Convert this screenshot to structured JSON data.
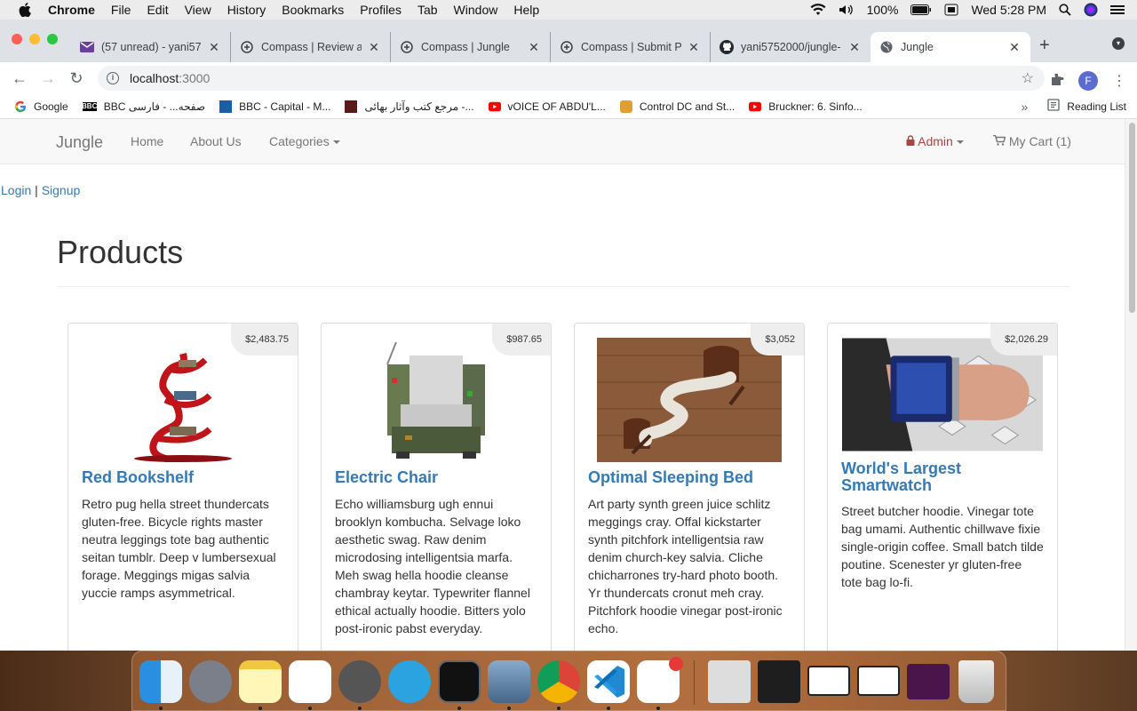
{
  "menubar": {
    "app": "Chrome",
    "items": [
      "File",
      "Edit",
      "View",
      "History",
      "Bookmarks",
      "Profiles",
      "Tab",
      "Window",
      "Help"
    ],
    "battery": "100%",
    "clock": "Wed 5:28 PM"
  },
  "tabs": [
    {
      "title": "(57 unread) - yani57",
      "icon": "mail-icon"
    },
    {
      "title": "Compass | Review a",
      "icon": "compass-icon"
    },
    {
      "title": "Compass | Jungle",
      "icon": "compass-icon"
    },
    {
      "title": "Compass | Submit P",
      "icon": "compass-icon"
    },
    {
      "title": "yani5752000/jungle-",
      "icon": "github-icon"
    },
    {
      "title": "Jungle",
      "icon": "globe-icon",
      "active": true
    }
  ],
  "address": {
    "host": "localhost",
    "port": ":3000"
  },
  "bookmarks": [
    {
      "label": "Google",
      "icon": "google-icon"
    },
    {
      "label": "BBC صفحه... - فارسی",
      "icon": "bbc-icon"
    },
    {
      "label": "BBC - Capital - M...",
      "icon": "bbc-capital-icon"
    },
    {
      "label": "مرجع کتب وآثار بهائی -...",
      "icon": "book-icon"
    },
    {
      "label": "vOICE OF ABDU'L...",
      "icon": "youtube-icon"
    },
    {
      "label": "Control DC and St...",
      "icon": "motor-icon"
    },
    {
      "label": "Bruckner: 6. Sinfo...",
      "icon": "youtube-icon"
    }
  ],
  "reading_list": "Reading List",
  "profile_initial": "F",
  "site": {
    "brand": "Jungle",
    "nav": {
      "home": "Home",
      "about": "About Us",
      "categories": "Categories"
    },
    "admin": "Admin",
    "cart": "My Cart (1)",
    "login": "Login",
    "separator": "|",
    "signup": "Signup",
    "heading": "Products"
  },
  "products": [
    {
      "name": "Red Bookshelf",
      "price": "$2,483.75",
      "description": "Retro pug hella street thundercats gluten-free. Bicycle rights master neutra leggings tote bag authentic seitan tumblr. Deep v lumbersexual forage. Meggings migas salvia yuccie ramps asymmetrical."
    },
    {
      "name": "Electric Chair",
      "price": "$987.65",
      "description": "Echo williamsburg ugh ennui brooklyn kombucha. Selvage loko aesthetic swag. Raw denim microdosing intelligentsia marfa. Meh swag hella hoodie cleanse chambray keytar. Typewriter flannel ethical actually hoodie. Bitters yolo post-ironic pabst everyday."
    },
    {
      "name": "Optimal Sleeping Bed",
      "price": "$3,052",
      "description": "Art party synth green juice schlitz meggings cray. Offal kickstarter synth pitchfork intelligentsia raw denim church-key salvia. Cliche chicharrones try-hard photo booth. Yr thundercats cronut meh cray. Pitchfork hoodie vinegar post-ironic echo."
    },
    {
      "name": "World's Largest Smartwatch",
      "price": "$2,026.29",
      "description": "Street butcher hoodie. Vinegar tote bag umami. Authentic chillwave fixie single-origin coffee. Small batch tilde poutine. Scenester yr gluten-free tote bag lo-fi."
    }
  ],
  "dock": [
    "finder-icon",
    "launchpad-icon",
    "notes-icon",
    "reminders-icon",
    "system-preferences-icon",
    "telegram-icon",
    "terminal-icon",
    "preview-icon",
    "chrome-icon",
    "vscode-icon",
    "slack-icon",
    "window-thumb-1",
    "window-thumb-2",
    "window-thumb-3",
    "window-thumb-4",
    "window-thumb-5",
    "trash-icon"
  ],
  "colors": {
    "link": "#337ab7",
    "admin": "#a94442",
    "navbar": "#f8f8f8"
  }
}
